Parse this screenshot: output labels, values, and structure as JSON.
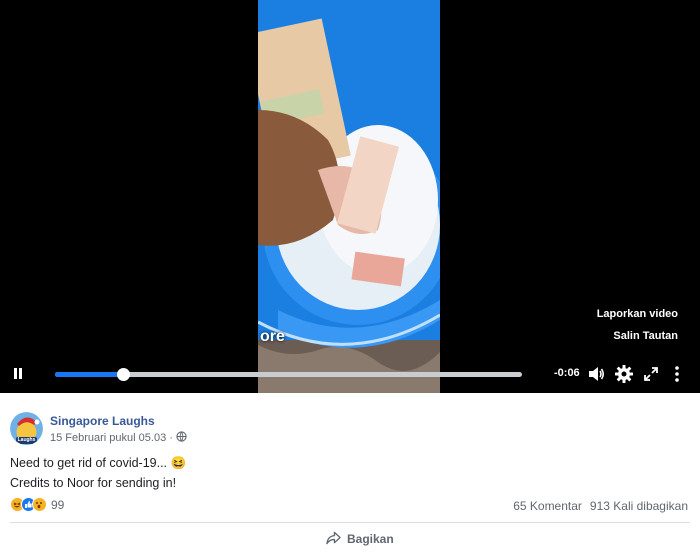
{
  "video": {
    "menu": [
      "Laporkan video",
      "Salin Tautan"
    ],
    "time_remaining": "-0:06",
    "progress": 0.146,
    "overlay_caption": "ore"
  },
  "post": {
    "page_name": "Singapore Laughs",
    "avatar_text": "Laughs",
    "timestamp": "15 Februari pukul 05.03 · ",
    "lines": [
      "Need to get rid of covid-19... 😆",
      "Credits to Noor for sending in!"
    ],
    "reaction_count": "99",
    "comments": "65 Komentar",
    "shares": "913 Kali dibagikan",
    "share_label": "Bagikan"
  },
  "colors": {
    "accent": "#1877f2",
    "link": "#385898",
    "muted": "#616770",
    "video_bg": "#000000"
  }
}
